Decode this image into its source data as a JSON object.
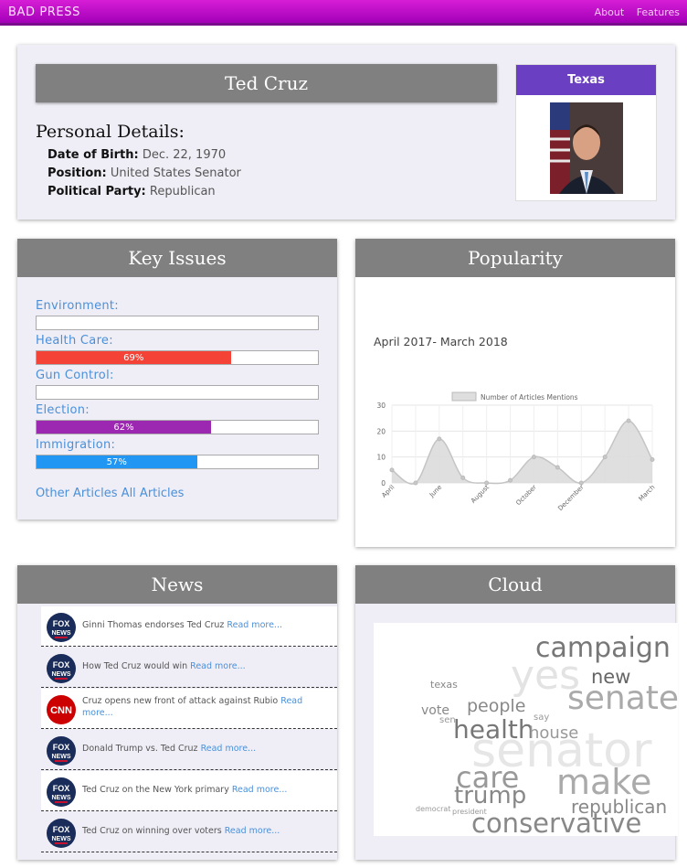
{
  "nav": {
    "brand": "BAD PRESS",
    "about": "About",
    "features": "Features"
  },
  "profile": {
    "name": "Ted Cruz",
    "section_title": "Personal Details:",
    "dob_label": "Date of Birth:",
    "dob": "Dec. 22, 1970",
    "position_label": "Position:",
    "position": "United States Senator",
    "party_label": "Political Party:",
    "party": "Republican",
    "state": "Texas"
  },
  "issues": {
    "title": "Key Issues",
    "items": [
      {
        "label": "Environment:",
        "percent": 0,
        "pct_text": "",
        "color": "#ffffff"
      },
      {
        "label": "Health Care:",
        "percent": 69,
        "pct_text": "69%",
        "color": "#f44336"
      },
      {
        "label": "Gun Control:",
        "percent": 0,
        "pct_text": "",
        "color": "#ffffff"
      },
      {
        "label": "Election:",
        "percent": 62,
        "pct_text": "62%",
        "color": "#9c27b0"
      },
      {
        "label": "Immigration:",
        "percent": 57,
        "pct_text": "57%",
        "color": "#2196f3"
      }
    ],
    "other_articles": "Other Articles",
    "all_articles": "All Articles"
  },
  "popularity": {
    "title": "Popularity",
    "range_text": "April 2017- March 2018"
  },
  "chart_data": {
    "type": "area",
    "legend": "Number of Articles Mentions",
    "x": [
      "April",
      "",
      "June",
      "",
      "August",
      "",
      "October",
      "",
      "December",
      "",
      "",
      "March"
    ],
    "tick_labels": [
      "April",
      "June",
      "August",
      "October",
      "December",
      "March"
    ],
    "values": [
      5,
      0,
      17,
      2,
      0,
      1,
      10,
      6,
      0,
      10,
      24,
      9
    ],
    "ylim": [
      0,
      30
    ],
    "yticks": [
      0,
      10,
      20,
      30
    ],
    "grid": true
  },
  "news": {
    "title": "News",
    "read_more": "Read more...",
    "items": [
      {
        "source": "FOX NEWS",
        "text": "Ginni Thomas endorses Ted Cruz"
      },
      {
        "source": "FOX NEWS",
        "text": "How Ted Cruz would win"
      },
      {
        "source": "CNN",
        "text": "Cruz opens new front of attack against Rubio"
      },
      {
        "source": "FOX NEWS",
        "text": "Donald Trump vs. Ted Cruz"
      },
      {
        "source": "FOX NEWS",
        "text": "Ted Cruz on the New York primary"
      },
      {
        "source": "FOX NEWS",
        "text": "Ted Cruz on winning over voters"
      }
    ]
  },
  "cloud": {
    "title": "Cloud",
    "words": [
      "campaign",
      "yes",
      "new",
      "senate",
      "texas",
      "vote",
      "people",
      "say",
      "sen",
      "health",
      "house",
      "senator",
      "care",
      "make",
      "trump",
      "republican",
      "democrat",
      "president",
      "conservative"
    ]
  }
}
